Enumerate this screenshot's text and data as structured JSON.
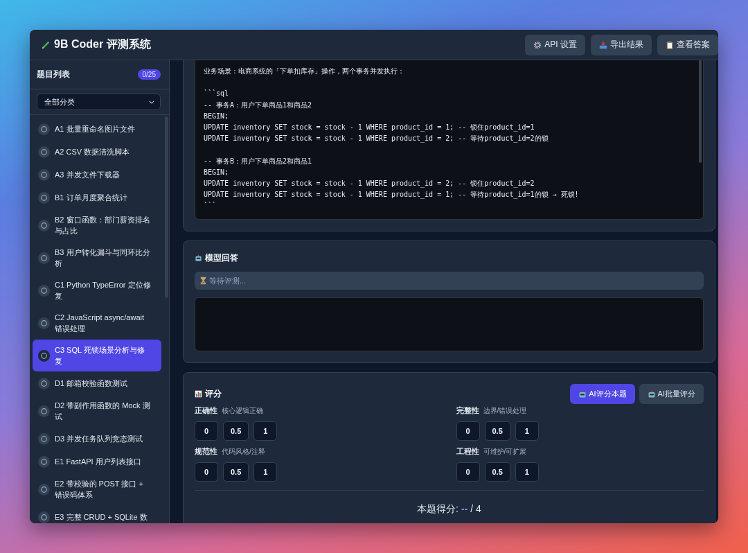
{
  "app": {
    "title": "9B Coder 评测系统"
  },
  "header_buttons": [
    {
      "kind": "settings",
      "label": "API 设置"
    },
    {
      "kind": "export",
      "label": "导出结果"
    },
    {
      "kind": "answers",
      "label": "查看答案"
    }
  ],
  "sidebar": {
    "title": "题目列表",
    "progress": "0/25",
    "filter": "全部分类",
    "items": [
      {
        "label": "A1 批量重命名图片文件",
        "selected": false
      },
      {
        "label": "A2 CSV 数据清洗脚本",
        "selected": false
      },
      {
        "label": "A3 并发文件下载器",
        "selected": false
      },
      {
        "label": "B1 订单月度聚合统计",
        "selected": false
      },
      {
        "label": "B2 窗口函数：部门薪资排名与占比",
        "selected": false
      },
      {
        "label": "B3 用户转化漏斗与同环比分析",
        "selected": false
      },
      {
        "label": "C1 Python TypeError 定位修复",
        "selected": false
      },
      {
        "label": "C2 JavaScript async/await 错误处理",
        "selected": false
      },
      {
        "label": "C3 SQL 死锁场景分析与修复",
        "selected": true
      },
      {
        "label": "D1 邮箱校验函数测试",
        "selected": false
      },
      {
        "label": "D2 带副作用函数的 Mock 测试",
        "selected": false
      },
      {
        "label": "D3 并发任务队列竞态测试",
        "selected": false
      },
      {
        "label": "E1 FastAPI 用户列表接口",
        "selected": false
      },
      {
        "label": "E2 带校验的 POST 接口 + 错误码体系",
        "selected": false
      },
      {
        "label": "E3 完整 CRUD + SQLite 数",
        "selected": false
      }
    ]
  },
  "problem": {
    "code": "业务场景：电商系统的「下单扣库存」操作，两个事务并发执行：\n\n```sql\n-- 事务A：用户下单商品1和商品2\nBEGIN;\nUPDATE inventory SET stock = stock - 1 WHERE product_id = 1; -- 锁住product_id=1\nUPDATE inventory SET stock = stock - 1 WHERE product_id = 2; -- 等待product_id=2的锁\n\n-- 事务B：用户下单商品2和商品1\nBEGIN;\nUPDATE inventory SET stock = stock - 1 WHERE product_id = 2; -- 锁住product_id=2\nUPDATE inventory SET stock = stock - 1 WHERE product_id = 1; -- 等待product_id=1的锁 → 死锁!\n```"
  },
  "answer": {
    "title": "模型回答",
    "status": "等待评测..."
  },
  "scoring": {
    "title": "评分",
    "buttons": [
      {
        "label": "AI评分本题",
        "primary": true
      },
      {
        "label": "AI批量评分",
        "primary": false
      }
    ],
    "criteria": [
      {
        "name": "正确性",
        "hint": "核心逻辑正确",
        "options": [
          {
            "label": "0",
            "selected": false
          },
          {
            "label": "0.5",
            "selected": false
          },
          {
            "label": "1",
            "selected": false
          }
        ]
      },
      {
        "name": "完整性",
        "hint": "边界/错误处理",
        "options": [
          {
            "label": "0",
            "selected": false
          },
          {
            "label": "0.5",
            "selected": false
          },
          {
            "label": "1",
            "selected": false
          }
        ]
      },
      {
        "name": "规范性",
        "hint": "代码风格/注释",
        "options": [
          {
            "label": "0",
            "selected": false
          },
          {
            "label": "0.5",
            "selected": false
          },
          {
            "label": "1",
            "selected": false
          }
        ]
      },
      {
        "name": "工程性",
        "hint": "可维护/可扩展",
        "options": [
          {
            "label": "0",
            "selected": false
          },
          {
            "label": "0.5",
            "selected": false
          },
          {
            "label": "1",
            "selected": false
          }
        ]
      }
    ],
    "total_label": "本题得分:",
    "total_value": "--",
    "total_max": "/ 4"
  }
}
